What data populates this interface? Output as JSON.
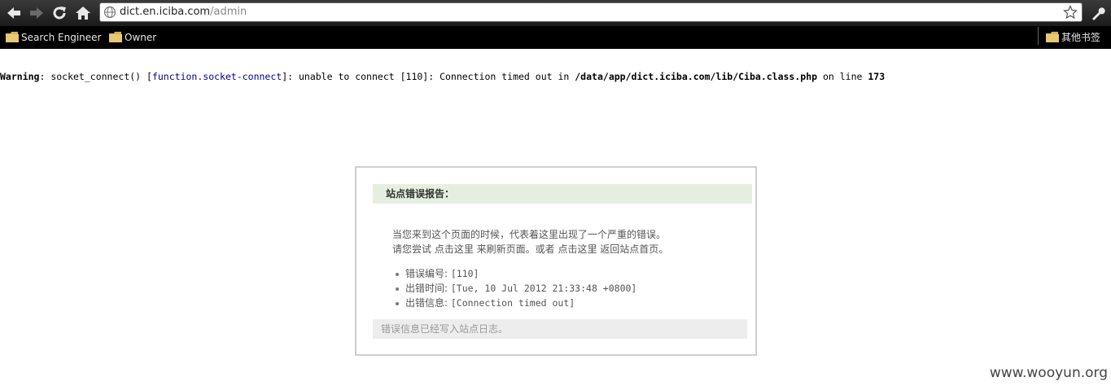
{
  "browser": {
    "url_domain": "dict.en.iciba.com",
    "url_path": "/admin",
    "bookmarks": [
      "Search Engineer",
      "Owner"
    ],
    "other_bookmarks": "其他书签"
  },
  "warning": {
    "label": "Warning",
    "text1": ": socket_connect() [",
    "link": "function.socket-connect",
    "text2": "]: unable to connect [110]: Connection timed out in ",
    "p1": "/",
    "p2": "data",
    "p3": "/",
    "p4": "app",
    "p5": "/",
    "p6": "dict.iciba.com",
    "p7": "/",
    "p8": "lib",
    "p9": "/",
    "p10": "Ciba.class.php",
    "text3": " on line ",
    "line": "173"
  },
  "error_report": {
    "title": "站点错误报告：",
    "message_line1": "当您来到这个页面的时候，代表着这里出现了一个严重的错误。",
    "message_line2": "请您尝试 点击这里 来刷新页面。或者 点击这里 返回站点首页。",
    "items": [
      {
        "label": "错误编号: ",
        "value": "[110]"
      },
      {
        "label": "出错时间: ",
        "value": "[Tue, 10 Jul 2012 21:33:48 +0800]"
      },
      {
        "label": "出错信息: ",
        "value": "[Connection timed out]"
      }
    ],
    "footer": "错误信息已经写入站点日志。"
  },
  "watermark": "www.wooyun.org",
  "colors": {
    "toolbar": "#2a2a2a",
    "bookmark_bar": "#000000",
    "header_bg": "#e6efdf",
    "footer_bg": "#ededed",
    "link": "#00008b"
  }
}
